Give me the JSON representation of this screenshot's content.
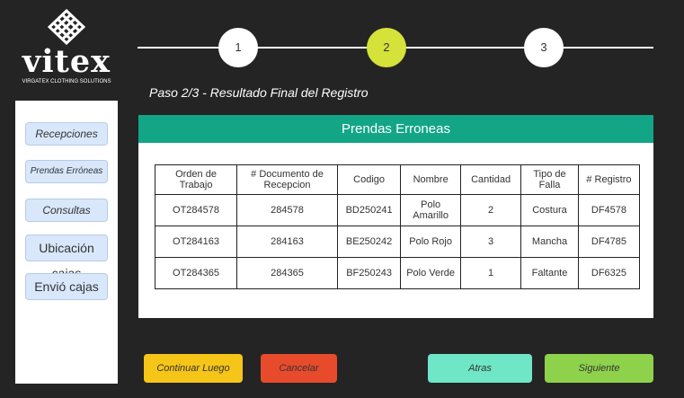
{
  "brand": {
    "name": "vitex",
    "tagline": "VIRGATEX CLOTHING SOLUTIONS"
  },
  "stepper": {
    "steps": [
      "1",
      "2",
      "3"
    ],
    "active_index": 1
  },
  "step_title": "Paso 2/3 - Resultado Final del Registro",
  "sidebar": {
    "items": [
      {
        "label": "Recepciones"
      },
      {
        "label": "Prendas Erróneas"
      },
      {
        "label": "Consultas"
      },
      {
        "label": "Ubicación cajas"
      },
      {
        "label": "Envió cajas"
      }
    ]
  },
  "panel": {
    "title": "Prendas Erroneas",
    "table": {
      "headers": [
        "Orden de Trabajo",
        "# Documento  de Recepcion",
        "Codigo",
        "Nombre",
        "Cantidad",
        "Tipo de Falla",
        "# Registro"
      ],
      "rows": [
        [
          "OT284578",
          "284578",
          "BD250241",
          "Polo Amarillo",
          "2",
          "Costura",
          "DF4578"
        ],
        [
          "OT284163",
          "284163",
          "BE250242",
          "Polo Rojo",
          "3",
          "Mancha",
          "DF4785"
        ],
        [
          "OT284365",
          "284365",
          "BF250243",
          "Polo Verde",
          "1",
          "Faltante",
          "DF6325"
        ]
      ]
    }
  },
  "actions": {
    "continue_later": "Continuar Luego",
    "cancel": "Cancelar",
    "back": "Atras",
    "next": "Siguiente"
  },
  "colors": {
    "background": "#242424",
    "active_step": "#d4e23a",
    "panel_header": "#12a586",
    "continue_button": "#f5c518",
    "cancel_button": "#e84b2c",
    "back_button": "#6fe6c6",
    "next_button": "#8ed24c"
  }
}
